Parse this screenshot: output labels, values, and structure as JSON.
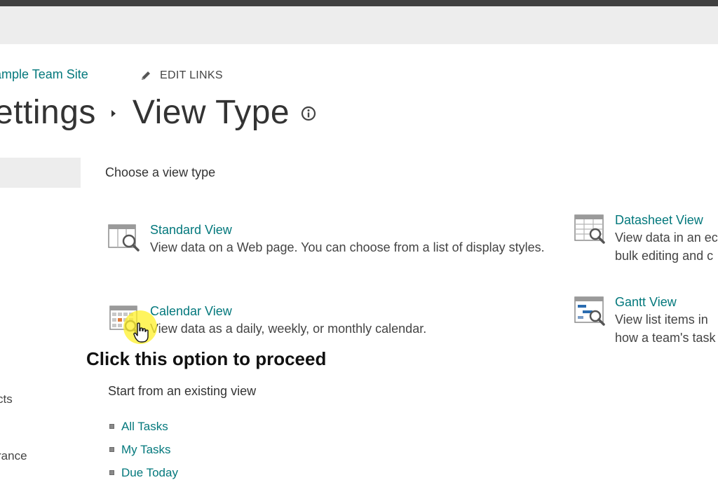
{
  "header": {
    "site_name": "ample Team Site",
    "edit_links": "EDIT LINKS",
    "breadcrumb_parent": "ettings",
    "page_title": "View Type"
  },
  "left_nav": {
    "item1": "cts",
    "item2": "rance"
  },
  "main": {
    "choose_heading": "Choose a view type",
    "view_types": [
      {
        "title": "Standard View",
        "desc_line1": "View data on a Web page. You can choose from a list of display styles.",
        "icon": "standard-view-icon"
      },
      {
        "title": "Calendar View",
        "desc_line1": "View data as a daily, weekly, or monthly calendar.",
        "icon": "calendar-view-icon"
      },
      {
        "title": "Datasheet View",
        "desc_line1": "View data in an ec",
        "desc_line2": "bulk editing and c",
        "icon": "datasheet-view-icon"
      },
      {
        "title": "Gantt View",
        "desc_line1": "View list items in",
        "desc_line2": "how a team's task",
        "icon": "gantt-view-icon"
      }
    ],
    "callout": "Click this option to proceed",
    "existing_heading": "Start from an existing view",
    "existing_views": [
      "All Tasks",
      "My Tasks",
      "Due Today"
    ]
  },
  "colors": {
    "link": "#03787c",
    "text": "#333333",
    "highlight": "#fff028"
  }
}
